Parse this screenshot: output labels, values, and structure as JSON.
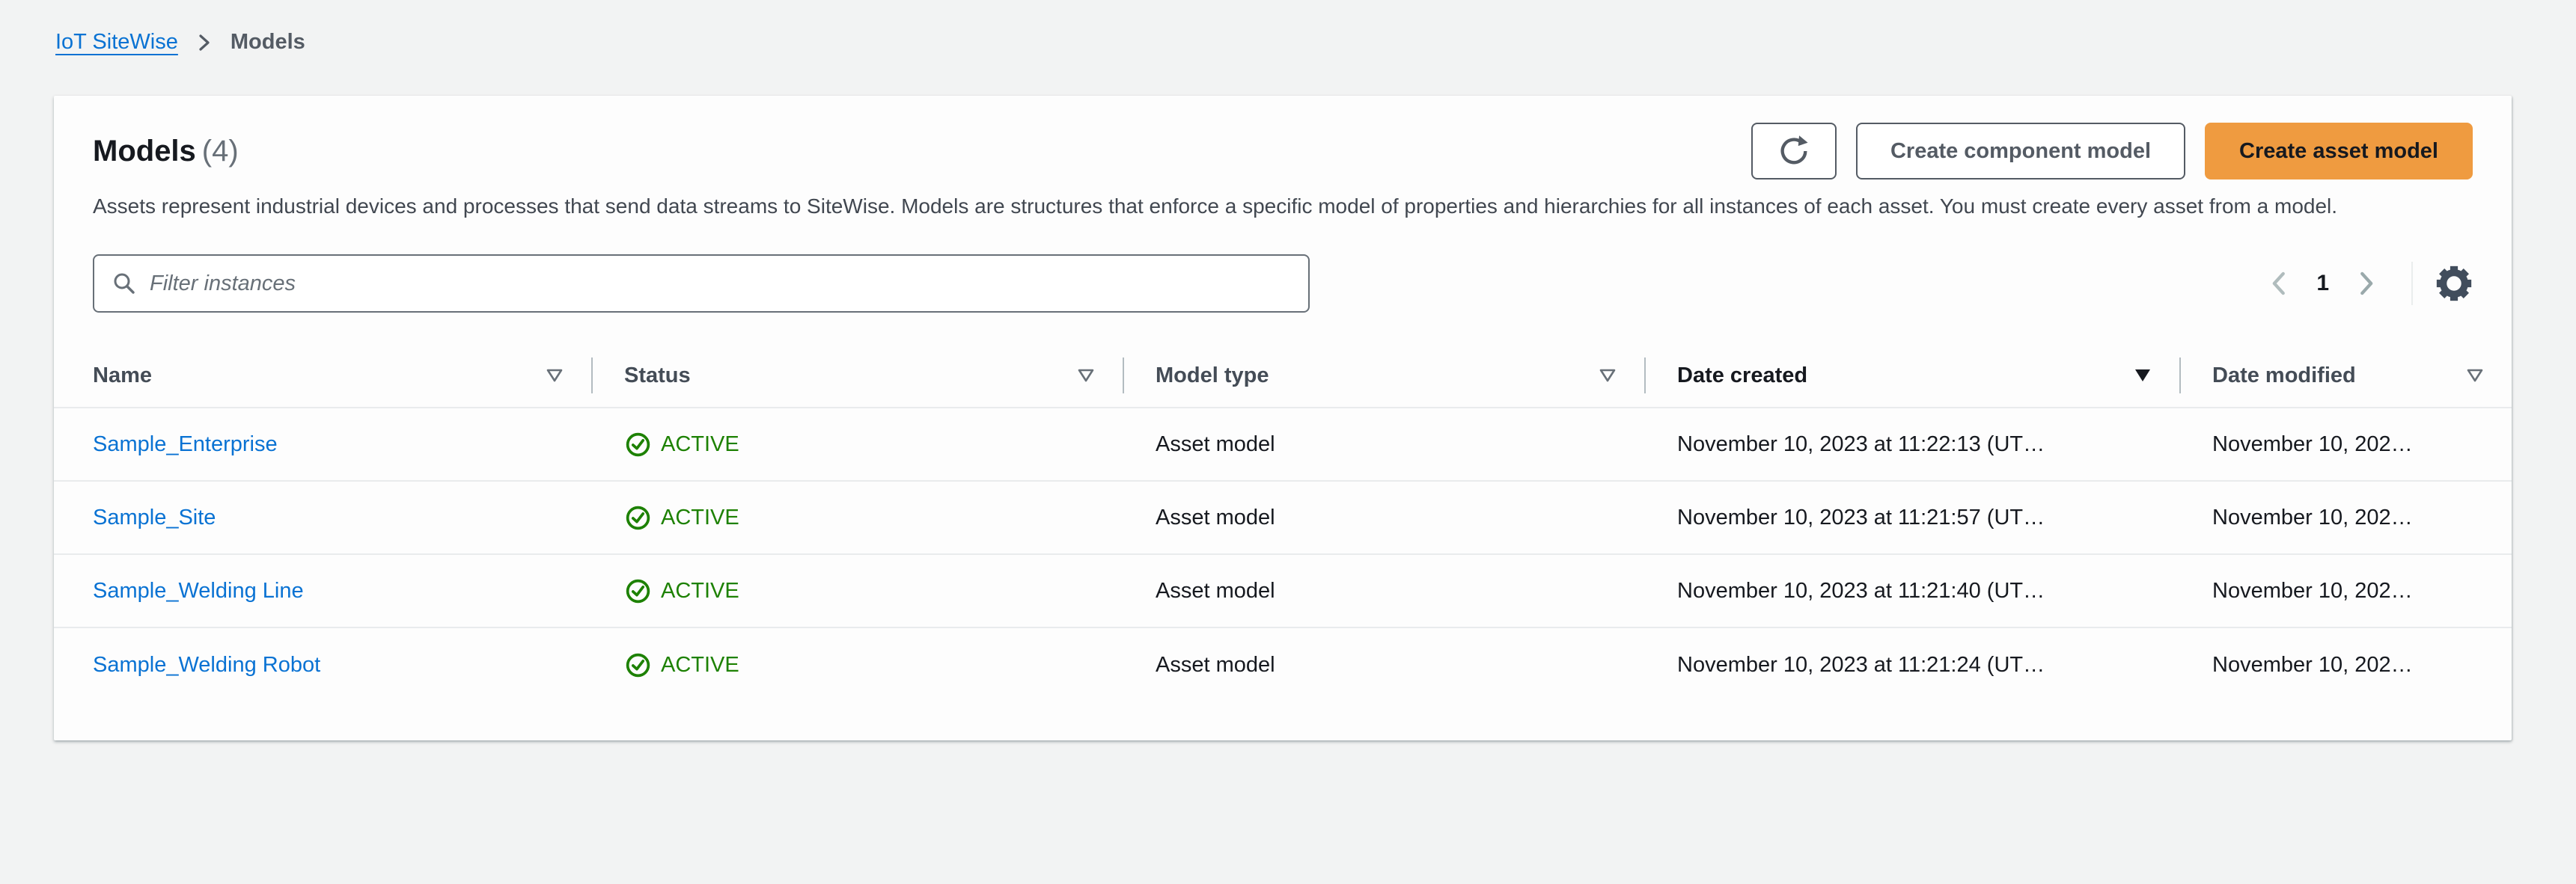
{
  "colors": {
    "accent_orange": "#ef9b40",
    "link_blue": "#0972d3",
    "status_green": "#1d8102",
    "page_background": "#f2f3f3"
  },
  "breadcrumb": {
    "root": "IoT SiteWise",
    "separator_icon": "chevron-right-icon",
    "current": "Models"
  },
  "header": {
    "title": "Models",
    "count": "(4)",
    "description": "Assets represent industrial devices and processes that send data streams to SiteWise. Models are structures that enforce a specific model of properties and hierarchies for all instances of each asset. You must create every asset from a model.",
    "refresh_icon": "refresh-icon",
    "secondary_button": "Create component model",
    "primary_button": "Create asset model"
  },
  "toolbar": {
    "filter_placeholder": "Filter instances",
    "search_icon": "search-icon",
    "pagination": {
      "prev_icon": "chevron-left-icon",
      "page": "1",
      "next_icon": "chevron-right-icon"
    },
    "settings_icon": "gear-icon"
  },
  "table": {
    "columns": [
      {
        "label": "Name",
        "sort": "unsorted"
      },
      {
        "label": "Status",
        "sort": "unsorted"
      },
      {
        "label": "Model type",
        "sort": "unsorted"
      },
      {
        "label": "Date created",
        "sort": "descending"
      },
      {
        "label": "Date modified",
        "sort": "unsorted"
      }
    ],
    "rows": [
      {
        "name": "Sample_Enterprise",
        "status": "ACTIVE",
        "model_type": "Asset model",
        "date_created": "November 10, 2023 at 11:22:13 (UT…",
        "date_modified": "November 10, 202…"
      },
      {
        "name": "Sample_Site",
        "status": "ACTIVE",
        "model_type": "Asset model",
        "date_created": "November 10, 2023 at 11:21:57 (UT…",
        "date_modified": "November 10, 202…"
      },
      {
        "name": "Sample_Welding Line",
        "status": "ACTIVE",
        "model_type": "Asset model",
        "date_created": "November 10, 2023 at 11:21:40 (UT…",
        "date_modified": "November 10, 202…"
      },
      {
        "name": "Sample_Welding Robot",
        "status": "ACTIVE",
        "model_type": "Asset model",
        "date_created": "November 10, 2023 at 11:21:24 (UT…",
        "date_modified": "November 10, 202…"
      }
    ]
  }
}
